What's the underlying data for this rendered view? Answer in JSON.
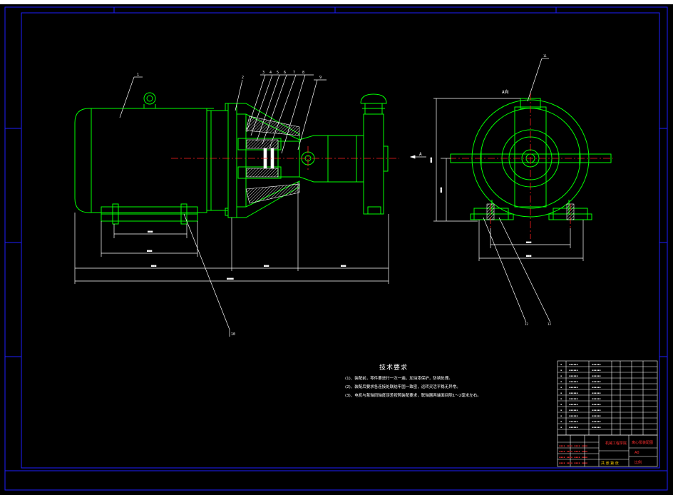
{
  "drawing": {
    "view_marker_a": "A",
    "view_label_a": "A向",
    "colors": {
      "background": "#000000",
      "frame": "#1e1eff",
      "outline": "#00ff00",
      "centerline": "#ff2020",
      "dimension": "#ffffff",
      "hatch": "#ffffff",
      "leader": "#ffffff"
    }
  },
  "tech_notes": {
    "title": "技术要求",
    "lines": [
      "(1)、装配前，零件要进行一次一遍，加油漆保护，防锈处理。",
      "(2)、装配后要求各连接处联结牢固一致密，运转灵活平稳无异常。",
      "(3)、电机与泵轴同轴度误差按照装配要求，联轴器两端面间隙1～2毫米左右。"
    ]
  },
  "title_block": {
    "school": "机械工程学院",
    "title": "离心泵装配图",
    "code": "A0",
    "scale_label": "比例",
    "sheet_label": "共 张 第 张"
  }
}
